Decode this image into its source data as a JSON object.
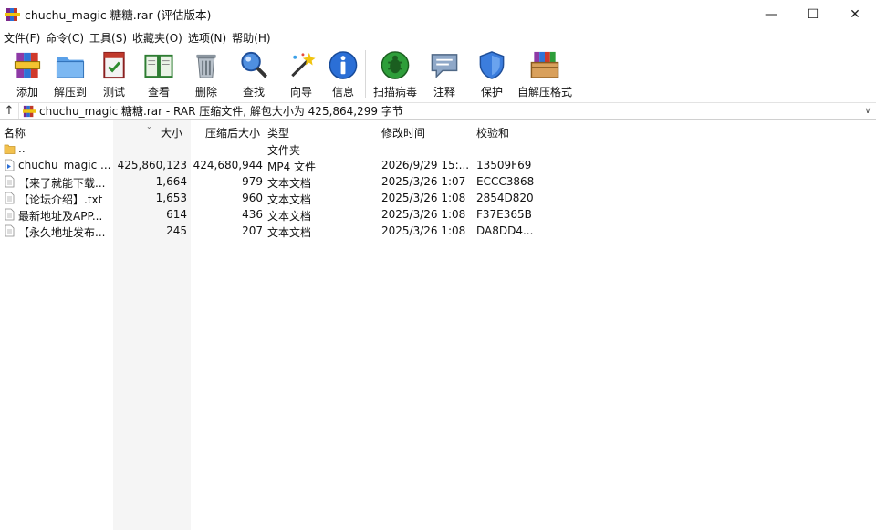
{
  "window": {
    "title": "chuchu_magic 糖糖.rar (评估版本)",
    "controls": {
      "minimize": "—",
      "maximize": "☐",
      "close": "✕"
    }
  },
  "menu": [
    "文件(F)",
    "命令(C)",
    "工具(S)",
    "收藏夹(O)",
    "选项(N)",
    "帮助(H)"
  ],
  "toolbar": [
    {
      "label": "添加",
      "icon": "add-archive-icon"
    },
    {
      "label": "解压到",
      "icon": "extract-to-icon"
    },
    {
      "label": "测试",
      "icon": "test-icon"
    },
    {
      "label": "查看",
      "icon": "view-book-icon"
    },
    {
      "label": "删除",
      "icon": "delete-trash-icon"
    },
    {
      "label": "查找",
      "icon": "find-magnifier-icon"
    },
    {
      "label": "向导",
      "icon": "wizard-wand-icon"
    },
    {
      "label": "信息",
      "icon": "info-icon"
    },
    {
      "label": "扫描病毒",
      "icon": "virus-scan-icon"
    },
    {
      "label": "注释",
      "icon": "comment-icon"
    },
    {
      "label": "保护",
      "icon": "protect-shield-icon"
    },
    {
      "label": "自解压格式",
      "icon": "sfx-box-icon"
    }
  ],
  "address": {
    "up": "↑",
    "text": "chuchu_magic 糖糖.rar - RAR 压缩文件, 解包大小为 425,864,299 字节",
    "dropdown": "∨"
  },
  "columns": {
    "name": "名称",
    "size": "大小",
    "packed": "压缩后大小",
    "type": "类型",
    "modified": "修改时间",
    "crc": "校验和"
  },
  "files": [
    {
      "name": "..",
      "size": "",
      "packed": "",
      "type": "文件夹",
      "modified": "",
      "crc": "",
      "icon": "folder-icon"
    },
    {
      "name": "chuchu_magic ...",
      "size": "425,860,123",
      "packed": "424,680,944",
      "type": "MP4 文件",
      "modified": "2026/9/29 15:...",
      "crc": "13509F69",
      "icon": "video-file-icon"
    },
    {
      "name": "【来了就能下载...",
      "size": "1,664",
      "packed": "979",
      "type": "文本文档",
      "modified": "2025/3/26 1:07",
      "crc": "ECCC3868",
      "icon": "text-file-icon"
    },
    {
      "name": "【论坛介绍】.txt",
      "size": "1,653",
      "packed": "960",
      "type": "文本文档",
      "modified": "2025/3/26 1:08",
      "crc": "2854D820",
      "icon": "text-file-icon"
    },
    {
      "name": "最新地址及APP...",
      "size": "614",
      "packed": "436",
      "type": "文本文档",
      "modified": "2025/3/26 1:08",
      "crc": "F37E365B",
      "icon": "text-file-icon"
    },
    {
      "name": "【永久地址发布...",
      "size": "245",
      "packed": "207",
      "type": "文本文档",
      "modified": "2025/3/26 1:08",
      "crc": "DA8DD4...",
      "icon": "text-file-icon"
    }
  ],
  "colors": {
    "accent": "#1f5fbf",
    "sizeColumnBg": "#f5f5f5"
  }
}
